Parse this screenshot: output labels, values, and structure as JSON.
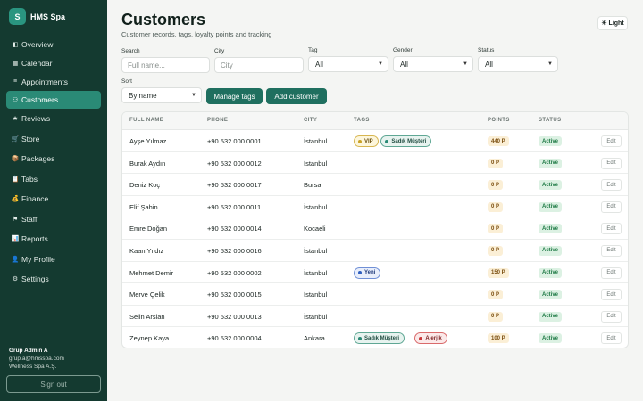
{
  "sidebar": {
    "brand_initial": "S",
    "brand_name": "HMS Spa",
    "items": [
      {
        "icon": "◧",
        "label": "Overview"
      },
      {
        "icon": "▦",
        "label": "Calendar"
      },
      {
        "icon": "≡",
        "label": "Appointments"
      },
      {
        "icon": "⚇",
        "label": "Customers"
      },
      {
        "icon": "★",
        "label": "Reviews"
      },
      {
        "icon": "🛒",
        "label": "Store"
      },
      {
        "icon": "📦",
        "label": "Packages"
      },
      {
        "icon": "📋",
        "label": "Tabs"
      },
      {
        "icon": "💰",
        "label": "Finance"
      },
      {
        "icon": "⚑",
        "label": "Staff"
      },
      {
        "icon": "📊",
        "label": "Reports"
      },
      {
        "icon": "👤",
        "label": "My Profile"
      },
      {
        "icon": "⚙",
        "label": "Settings"
      }
    ],
    "active_index": 3,
    "user": {
      "name": "Grup Admin A",
      "email": "grup.a@hmsspa.com",
      "org": "Wellness Spa A.Ş."
    },
    "signout_label": "Sign out"
  },
  "header": {
    "title": "Customers",
    "subtitle": "Customer records, tags, loyalty points and tracking",
    "theme_label": "☀ Light"
  },
  "filters": {
    "search_label": "Search",
    "search_placeholder": "Full name...",
    "city_label": "City",
    "city_placeholder": "City",
    "tag_label": "Tag",
    "tag_value": "All",
    "gender_label": "Gender",
    "gender_value": "All",
    "status_label": "Status",
    "status_value": "All",
    "sort_label": "Sort",
    "sort_value": "By name",
    "manage_tags_label": "Manage tags",
    "add_customer_label": "Add customer"
  },
  "table": {
    "columns": [
      "FULL NAME",
      "PHONE",
      "CITY",
      "TAGS",
      "POINTS",
      "STATUS"
    ],
    "edit_label": "Edit",
    "rows": [
      {
        "name": "Ayşe Yılmaz",
        "phone": "+90 532 000 0001",
        "city": "İstanbul",
        "tags": [
          {
            "label": "VIP",
            "style": "vip"
          },
          {
            "label": "Sadık Müşteri",
            "style": "sadik"
          }
        ],
        "points": "440 P",
        "status": "Active"
      },
      {
        "name": "Burak Aydın",
        "phone": "+90 532 000 0012",
        "city": "İstanbul",
        "tags": [],
        "points": "0 P",
        "status": "Active"
      },
      {
        "name": "Deniz Koç",
        "phone": "+90 532 000 0017",
        "city": "Bursa",
        "tags": [],
        "points": "0 P",
        "status": "Active"
      },
      {
        "name": "Elif Şahin",
        "phone": "+90 532 000 0011",
        "city": "İstanbul",
        "tags": [],
        "points": "0 P",
        "status": "Active"
      },
      {
        "name": "Emre Doğan",
        "phone": "+90 532 000 0014",
        "city": "Kocaeli",
        "tags": [],
        "points": "0 P",
        "status": "Active"
      },
      {
        "name": "Kaan Yıldız",
        "phone": "+90 532 000 0016",
        "city": "İstanbul",
        "tags": [],
        "points": "0 P",
        "status": "Active"
      },
      {
        "name": "Mehmet Demir",
        "phone": "+90 532 000 0002",
        "city": "İstanbul",
        "tags": [
          {
            "label": "Yeni",
            "style": "yeni"
          }
        ],
        "points": "150 P",
        "status": "Active"
      },
      {
        "name": "Merve Çelik",
        "phone": "+90 532 000 0015",
        "city": "İstanbul",
        "tags": [],
        "points": "0 P",
        "status": "Active"
      },
      {
        "name": "Selin Arslan",
        "phone": "+90 532 000 0013",
        "city": "İstanbul",
        "tags": [],
        "points": "0 P",
        "status": "Active"
      },
      {
        "name": "Zeynep Kaya",
        "phone": "+90 532 000 0004",
        "city": "Ankara",
        "tags": [
          {
            "label": "Sadık Müşteri",
            "style": "sadik"
          },
          {
            "label": "Alerjik",
            "style": "alerjik"
          }
        ],
        "points": "100 P",
        "status": "Active"
      }
    ]
  },
  "colors": {
    "sidebar_bg": "#143a30",
    "accent": "#1f6f5f",
    "active_nav": "#2a8a76",
    "tag_vip": "#c9a227",
    "tag_sadik": "#2a8a76",
    "tag_yeni": "#2f5fbf",
    "tag_alerjik": "#c9383a"
  }
}
